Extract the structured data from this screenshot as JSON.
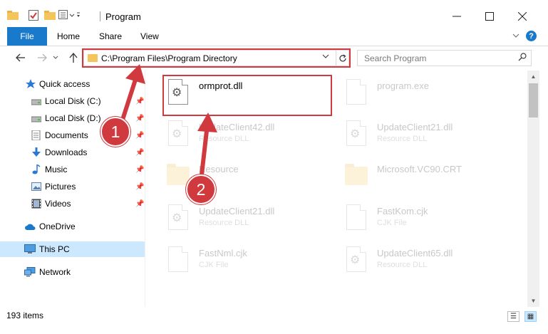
{
  "window": {
    "title": "Program",
    "minimize_icon": "minimize-icon",
    "maximize_icon": "maximize-icon",
    "close_icon": "close-icon"
  },
  "ribbon": {
    "tabs": [
      "File",
      "Home",
      "Share",
      "View"
    ],
    "accent": "#1979ca"
  },
  "address_bar": {
    "path": "C:\\Program Files\\Program Directory"
  },
  "search": {
    "placeholder": "Search Program"
  },
  "nav_pane": {
    "quick_access": "Quick access",
    "items": [
      {
        "label": "Local Disk (C:)",
        "icon": "drive-icon",
        "pinned": true
      },
      {
        "label": "Local Disk (D:)",
        "icon": "drive-icon",
        "pinned": true
      },
      {
        "label": "Documents",
        "icon": "documents-icon",
        "pinned": true
      },
      {
        "label": "Downloads",
        "icon": "downloads-icon",
        "pinned": true
      },
      {
        "label": "Music",
        "icon": "music-icon",
        "pinned": true
      },
      {
        "label": "Pictures",
        "icon": "pictures-icon",
        "pinned": true
      },
      {
        "label": "Videos",
        "icon": "videos-icon",
        "pinned": true
      }
    ],
    "onedrive": "OneDrive",
    "this_pc": "This PC",
    "network": "Network"
  },
  "files": [
    {
      "name": "ormprot.dll",
      "type": "",
      "icon": "dll-icon",
      "highlighted": true
    },
    {
      "name": "program.exe",
      "type": "",
      "icon": "exe-icon",
      "highlighted": false
    },
    {
      "name": "UpdateClient42.dll",
      "type": "Resource DLL",
      "icon": "dll-icon",
      "highlighted": false
    },
    {
      "name": "UpdateClient21.dll",
      "type": "Resource DLL",
      "icon": "dll-icon",
      "highlighted": false
    },
    {
      "name": "Resource",
      "type": "",
      "icon": "folder-icon",
      "highlighted": false
    },
    {
      "name": "Microsoft.VC90.CRT",
      "type": "",
      "icon": "folder-icon",
      "highlighted": false
    },
    {
      "name": "UpdateClient21.dll",
      "type": "Resource DLL",
      "icon": "dll-icon",
      "highlighted": false
    },
    {
      "name": "FastKom.cjk",
      "type": "CJK File",
      "icon": "file-icon",
      "highlighted": false
    },
    {
      "name": "FastNml.cjk",
      "type": "CJK File",
      "icon": "file-icon",
      "highlighted": false
    },
    {
      "name": "UpdateClient65.dll",
      "type": "Resource DLL",
      "icon": "dll-icon",
      "highlighted": false
    }
  ],
  "status": {
    "item_count": "193 items"
  },
  "annotations": {
    "step1": "1",
    "step2": "2",
    "color": "#d0393e"
  }
}
